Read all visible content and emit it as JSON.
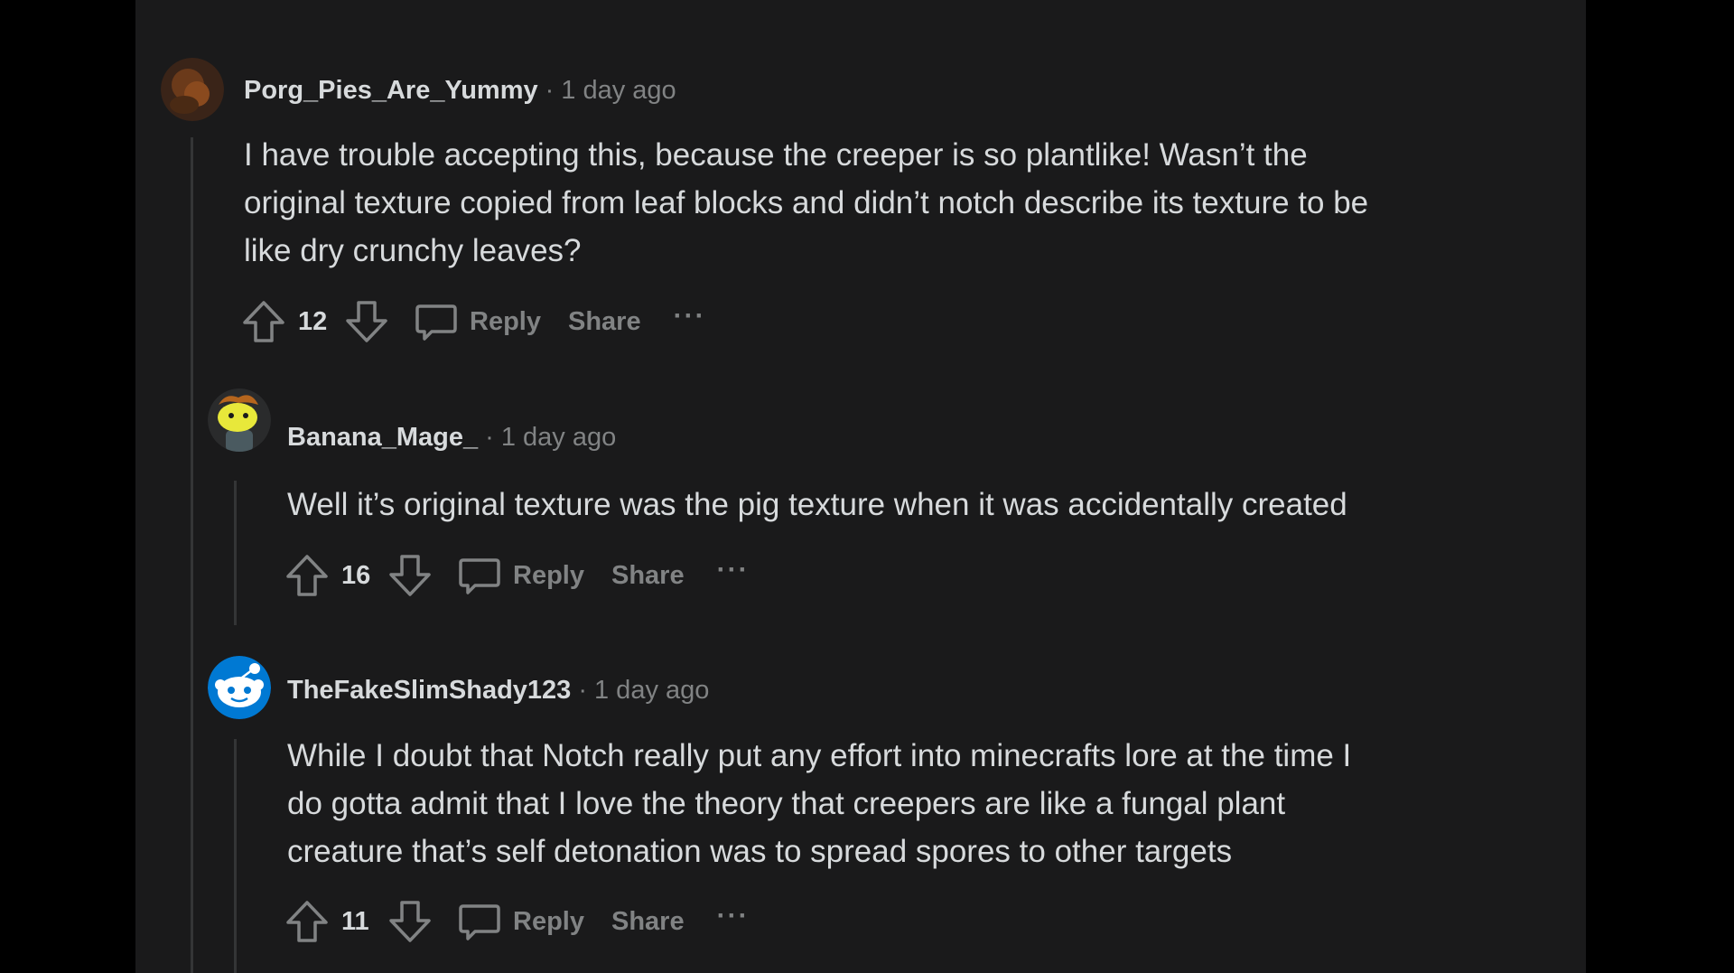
{
  "comments": [
    {
      "username": "Porg_Pies_Are_Yummy",
      "separator": "·",
      "time": "1 day ago",
      "body_lines": [
        "I have trouble accepting this, because the creeper is so plantlike! Wasn’t the",
        "original texture copied from leaf blocks and didn’t notch describe its texture to be",
        "like dry crunchy leaves?"
      ],
      "votes": "12",
      "reply_label": "Reply",
      "share_label": "Share",
      "more_label": "···",
      "avatar_colors": {
        "bg": "#3a2418",
        "accent": "#8a4a1e"
      }
    },
    {
      "username": "Banana_Mage_",
      "separator": "·",
      "time": "1 day ago",
      "body_lines": [
        "Well it’s original texture was the pig texture when it was accidentally created"
      ],
      "votes": "16",
      "reply_label": "Reply",
      "share_label": "Share",
      "more_label": "···",
      "avatar_colors": {
        "bg": "#2a2b2c",
        "head": "#e8e83a",
        "hair": "#b5651d",
        "body": "#4a5a60"
      }
    },
    {
      "username": "TheFakeSlimShady123",
      "separator": "·",
      "time": "1 day ago",
      "body_lines": [
        "While I doubt that Notch really put any effort into minecrafts lore at the time I",
        "do gotta admit that I love the theory that creepers are like a fungal plant",
        "creature that’s self detonation was to spread spores to other targets"
      ],
      "votes": "11",
      "reply_label": "Reply",
      "share_label": "Share",
      "more_label": "···",
      "avatar_colors": {
        "bg": "#0079d3",
        "face": "#ffffff"
      }
    }
  ],
  "colors": {
    "panel_bg": "#1a1a1b",
    "text_primary": "#d7dadc",
    "text_secondary": "#818384",
    "thread_line": "#343536"
  },
  "icons": [
    "upvote-icon",
    "downvote-icon",
    "comment-icon",
    "more-icon"
  ]
}
